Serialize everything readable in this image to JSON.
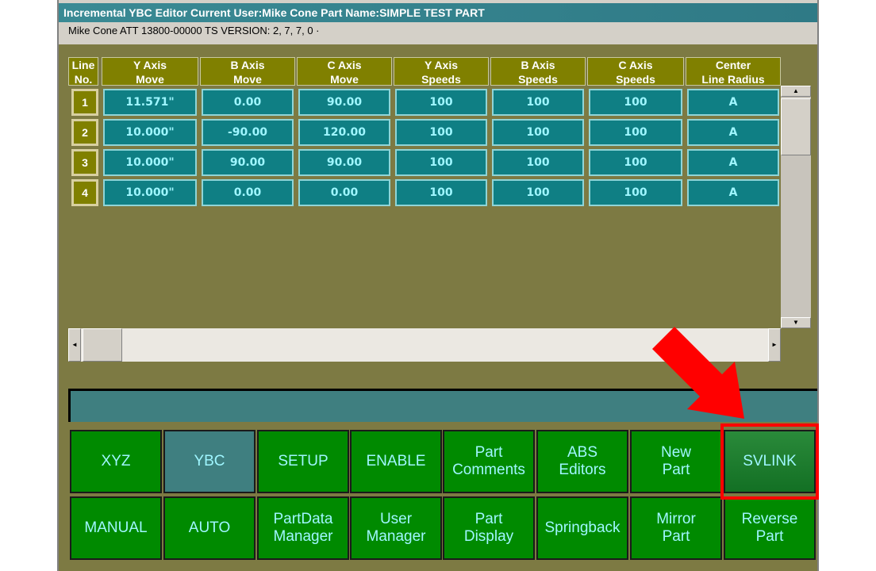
{
  "title": "Incremental YBC Editor  Current User:Mike Cone  Part Name:SIMPLE TEST PART",
  "info": "Mike Cone ATT     13800-00000   TS VERSION: 2, 7, 7, 0  ·",
  "headers": [
    "Line\nNo.",
    "Y Axis\nMove",
    "B Axis\nMove",
    "C Axis\nMove",
    "Y Axis\nSpeeds",
    "B Axis\nSpeeds",
    "C Axis\nSpeeds",
    "Center\nLine Radius"
  ],
  "rows": [
    {
      "no": "1",
      "y": "11.571\"",
      "b": "0.00",
      "c": "90.00",
      "ys": "100",
      "bs": "100",
      "cs": "100",
      "r": "A"
    },
    {
      "no": "2",
      "y": "10.000\"",
      "b": "-90.00",
      "c": "120.00",
      "ys": "100",
      "bs": "100",
      "cs": "100",
      "r": "A"
    },
    {
      "no": "3",
      "y": "10.000\"",
      "b": "90.00",
      "c": "90.00",
      "ys": "100",
      "bs": "100",
      "cs": "100",
      "r": "A"
    },
    {
      "no": "4",
      "y": "10.000\"",
      "b": "0.00",
      "c": "0.00",
      "ys": "100",
      "bs": "100",
      "cs": "100",
      "r": "A"
    }
  ],
  "buttons_row1": [
    "XYZ",
    "YBC",
    "SETUP",
    "ENABLE",
    "Part\nComments",
    "ABS\nEditors",
    "New\nPart",
    "SVLINK"
  ],
  "buttons_row2": [
    "MANUAL",
    "AUTO",
    "PartData\nManager",
    "User\nManager",
    "Part\nDisplay",
    "Springback",
    "Mirror\nPart",
    "Reverse\nPart"
  ],
  "scroll": {
    "up": "▲",
    "down": "▼",
    "left": "◄",
    "right": "►"
  }
}
